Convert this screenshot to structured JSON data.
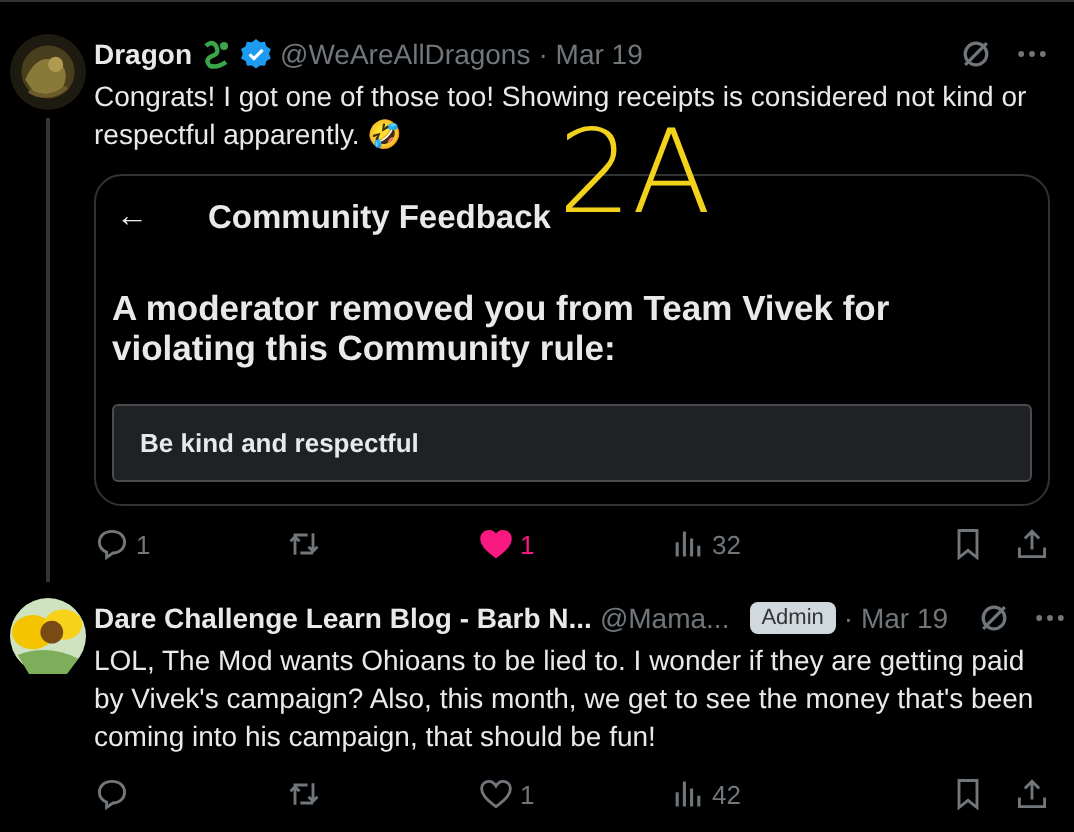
{
  "tweets": [
    {
      "author": "Dragon",
      "author_emoji": true,
      "verified": true,
      "handle": "@WeAreAllDragons",
      "date": "· Mar 19",
      "thread_line": true,
      "text": "Congrats! I got one of those too! Showing receipts is considered not kind or respectful apparently. 🤣",
      "card": {
        "back": "←",
        "title": "Community Feedback",
        "heading": "A moderator removed you from Team Vivek for violating this Community rule:",
        "rule": "Be kind and respectful"
      },
      "annotation": "2A",
      "actions": {
        "replies": "1",
        "likes": "1",
        "liked": true,
        "views": "32"
      }
    },
    {
      "author": "Dare Challenge Learn Blog - Barb N...",
      "author_emoji": false,
      "verified": false,
      "handle": "@Mama...",
      "badge": "Admin",
      "date": "· Mar 19",
      "thread_line": false,
      "text": "LOL, The Mod wants Ohioans to be lied to. I wonder if they are getting paid by Vivek's campaign? Also, this month, we get to see the money that's been coming into his campaign, that should be fun!",
      "actions": {
        "likes": "1",
        "liked": false,
        "views": "42"
      }
    }
  ]
}
